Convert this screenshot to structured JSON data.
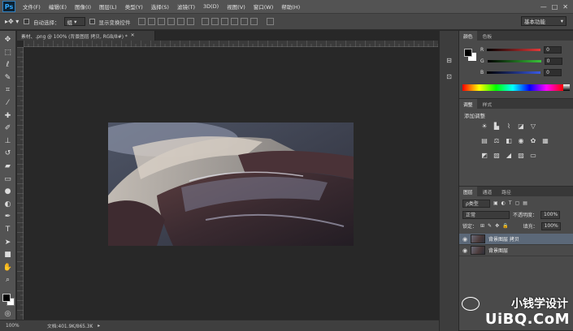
{
  "app": {
    "logo": "Ps"
  },
  "menu": [
    "文件(F)",
    "编辑(E)",
    "图像(I)",
    "图层(L)",
    "类型(Y)",
    "选择(S)",
    "滤镜(T)",
    "3D(D)",
    "视图(V)",
    "窗口(W)",
    "帮助(H)"
  ],
  "window_controls": [
    "—",
    "□",
    "✕"
  ],
  "options": {
    "auto_select_label": "自动选择：",
    "auto_select_value": "组",
    "show_transform_label": "显示变换控件",
    "workspace": "基本功能"
  },
  "document": {
    "tab_title": "素材、.png @ 100% (背景图层 拷贝, RGB/8#) *"
  },
  "status": {
    "zoom": "100%",
    "doc_info": "文档:401.9K/865.3K"
  },
  "color_panel": {
    "tabs": [
      "颜色",
      "色板"
    ],
    "sliders": [
      {
        "label": "R",
        "value": "0",
        "color": "#e43a3a"
      },
      {
        "label": "G",
        "value": "0",
        "color": "#3ac43a"
      },
      {
        "label": "B",
        "value": "0",
        "color": "#3a5ae4"
      }
    ]
  },
  "adjust_panel": {
    "tabs": [
      "调整",
      "样式"
    ],
    "title": "添加调整",
    "icons": [
      "brightness-icon",
      "levels-icon",
      "curves-icon",
      "exposure-icon",
      "vibrance-icon",
      "hue-icon",
      "balance-icon",
      "bw-icon",
      "photo-filter-icon",
      "channel-mixer-icon",
      "lookup-icon",
      "invert-icon",
      "posterize-icon",
      "threshold-icon",
      "selective-color-icon",
      "gradient-map-icon"
    ]
  },
  "layers_panel": {
    "tabs": [
      "图层",
      "通道",
      "路径"
    ],
    "filter": "ρ类型",
    "blend_mode": "正常",
    "opacity_label": "不透明度：",
    "opacity": "100%",
    "lock_label": "锁定：",
    "fill_label": "填充：",
    "fill": "100%",
    "layers": [
      {
        "name": "背景图层 拷贝",
        "selected": true
      },
      {
        "name": "背景图层",
        "selected": false
      }
    ]
  },
  "watermark": {
    "line1": "小钱学设计",
    "line2": "UiBQ.CoM"
  }
}
